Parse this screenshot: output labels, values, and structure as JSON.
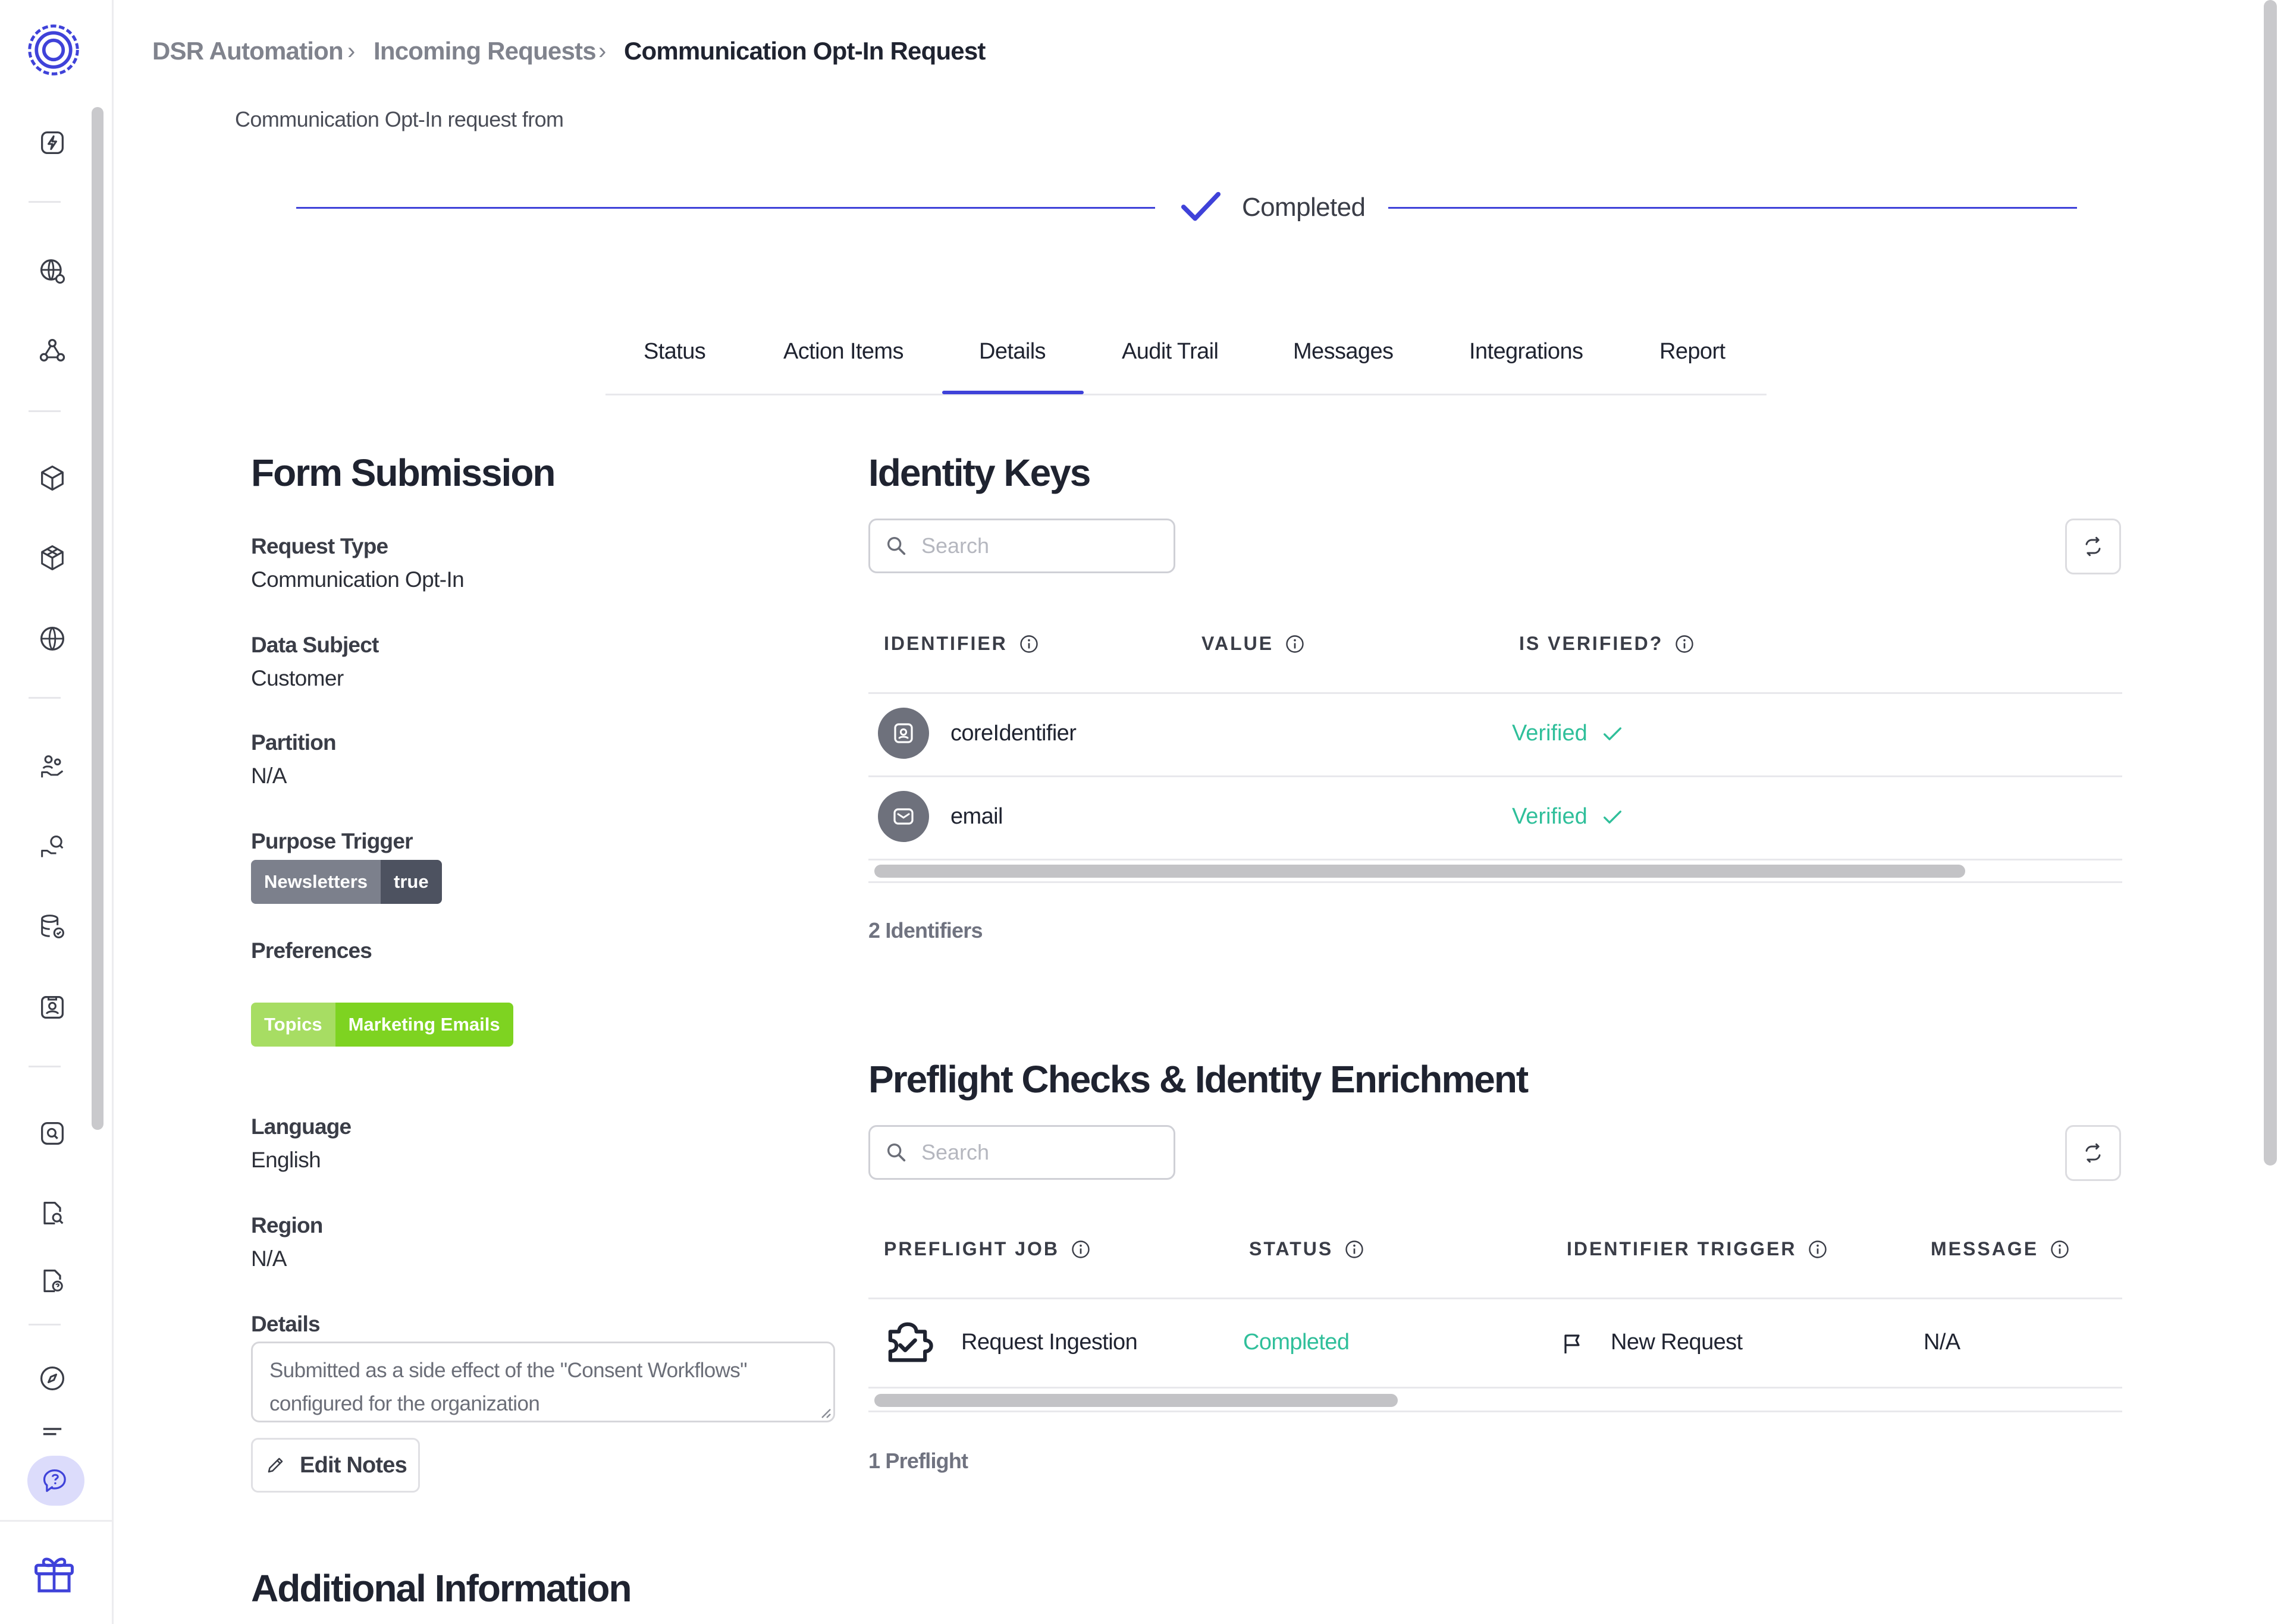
{
  "breadcrumb": {
    "items": [
      "DSR Automation",
      "Incoming Requests",
      "Communication Opt-In Request"
    ]
  },
  "page": {
    "subtitle": "Communication Opt-In request from",
    "status": "Completed"
  },
  "tabs": [
    {
      "label": "Status"
    },
    {
      "label": "Action Items"
    },
    {
      "label": "Details"
    },
    {
      "label": "Audit Trail"
    },
    {
      "label": "Messages"
    },
    {
      "label": "Integrations"
    },
    {
      "label": "Report"
    }
  ],
  "active_tab": "Details",
  "form_submission": {
    "title": "Form Submission",
    "request_type_label": "Request Type",
    "request_type": "Communication Opt-In",
    "data_subject_label": "Data Subject",
    "data_subject": "Customer",
    "partition_label": "Partition",
    "partition": "N/A",
    "purpose_trigger_label": "Purpose Trigger",
    "purpose_trigger_key": "Newsletters",
    "purpose_trigger_value": "true",
    "preferences_label": "Preferences",
    "preferences_key": "Topics",
    "preferences_value": "Marketing Emails",
    "language_label": "Language",
    "language": "English",
    "region_label": "Region",
    "region": "N/A",
    "details_label": "Details",
    "details_text": "Submitted as a side effect of the \"Consent Workflows\" configured for the organization",
    "edit_notes_label": "Edit Notes"
  },
  "additional_info": {
    "title": "Additional Information"
  },
  "identity_keys": {
    "title": "Identity Keys",
    "search_placeholder": "Search",
    "columns": [
      "IDENTIFIER",
      "VALUE",
      "IS VERIFIED?"
    ],
    "rows": [
      {
        "identifier": "coreIdentifier",
        "value": "",
        "verified": "Verified",
        "icon": "contact-card-icon"
      },
      {
        "identifier": "email",
        "value": "",
        "verified": "Verified",
        "icon": "envelope-icon"
      }
    ],
    "count": "2 Identifiers"
  },
  "preflight": {
    "title": "Preflight Checks & Identity Enrichment",
    "search_placeholder": "Search",
    "columns": [
      "PREFLIGHT JOB",
      "STATUS",
      "IDENTIFIER TRIGGER",
      "MESSAGE"
    ],
    "rows": [
      {
        "job": "Request Ingestion",
        "status": "Completed",
        "trigger": "New Request",
        "message": "N/A"
      }
    ],
    "count": "1 Preflight"
  },
  "colors": {
    "accent": "#3f42d9",
    "verified_green": "#2fbf9a",
    "pill_gray_dark": "#4d5260",
    "pill_gray": "#7c808c",
    "pill_green": "#7ed321",
    "pill_green_light": "#a7dd63"
  }
}
